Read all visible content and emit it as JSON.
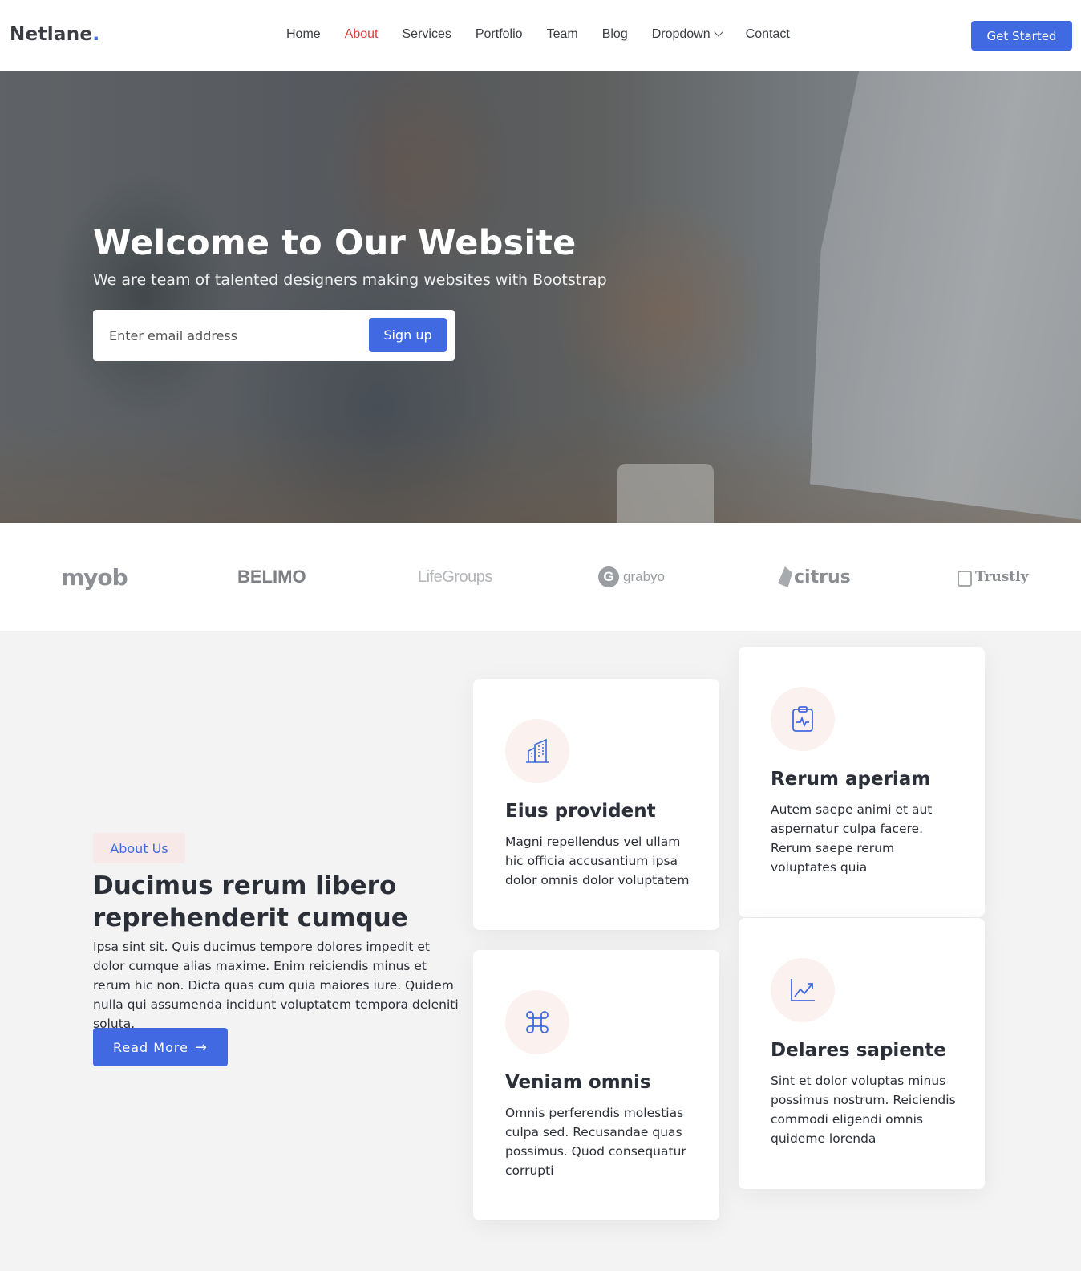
{
  "header": {
    "logo": "Netlane",
    "logo_dot": ".",
    "nav": [
      {
        "label": "Home"
      },
      {
        "label": "About",
        "active": true
      },
      {
        "label": "Services"
      },
      {
        "label": "Portfolio"
      },
      {
        "label": "Team"
      },
      {
        "label": "Blog"
      },
      {
        "label": "Dropdown"
      },
      {
        "label": "Contact"
      }
    ],
    "cta": "Get Started"
  },
  "hero": {
    "title": "Welcome to Our Website",
    "subtitle": "We are team of talented designers making websites with Bootstrap",
    "email_placeholder": "Enter email address",
    "signup_label": "Sign up"
  },
  "clients": [
    {
      "name": "myob"
    },
    {
      "name": "BELIMO"
    },
    {
      "name": "LifeGroups"
    },
    {
      "name": "grabyo",
      "mark": "G"
    },
    {
      "name": "citrus"
    },
    {
      "name": "Trustly"
    }
  ],
  "about": {
    "badge": "About Us",
    "title": "Ducimus rerum libero reprehenderit cumque",
    "text": "Ipsa sint sit. Quis ducimus tempore dolores impedit et dolor cumque alias maxime. Enim reiciendis minus et rerum hic non. Dicta quas cum quia maiores iure. Quidem nulla qui assumenda incidunt voluptatem tempora deleniti soluta.",
    "button": "Read More",
    "button_arrow": "→"
  },
  "cards": [
    {
      "icon": "building-icon",
      "title": "Eius provident",
      "text": "Magni repellendus vel ullam hic officia accusantium ipsa dolor omnis dolor voluptatem"
    },
    {
      "icon": "clipboard-pulse-icon",
      "title": "Rerum aperiam",
      "text": "Autem saepe animi et aut aspernatur culpa facere. Rerum saepe rerum voluptates quia"
    },
    {
      "icon": "command-icon",
      "title": "Veniam omnis",
      "text": "Omnis perferendis molestias culpa sed. Recusandae quas possimus. Quod consequatur corrupti"
    },
    {
      "icon": "graph-up-icon",
      "title": "Delares sapiente",
      "text": "Sint et dolor voluptas minus possimus nostrum. Reiciendis commodi eligendi omnis quideme lorenda"
    }
  ],
  "colors": {
    "accent": "#4169e1",
    "active_nav": "#e03b3b",
    "badge_bg": "#f6e9e7",
    "icon_bg": "#fbf1ef"
  }
}
